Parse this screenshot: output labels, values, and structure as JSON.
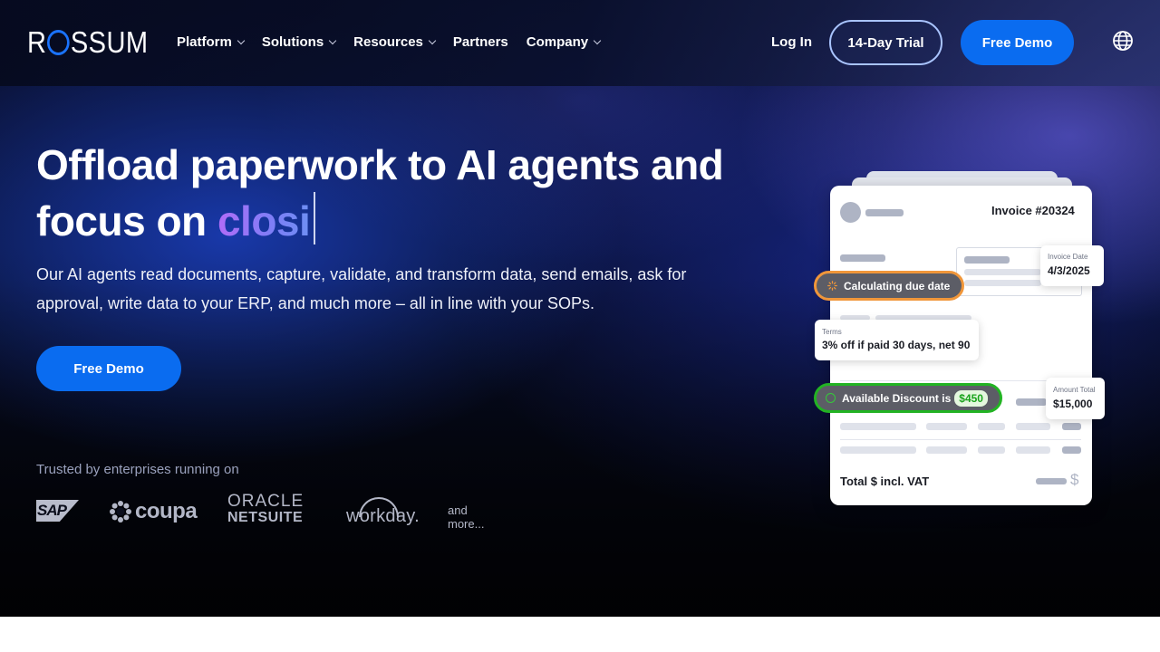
{
  "brand": {
    "logo_text_left": "R",
    "logo_text_right": "SSUM"
  },
  "nav": {
    "menu": [
      {
        "label": "Platform",
        "has_dropdown": true
      },
      {
        "label": "Solutions",
        "has_dropdown": true
      },
      {
        "label": "Resources",
        "has_dropdown": true
      },
      {
        "label": "Partners",
        "has_dropdown": false
      },
      {
        "label": "Company",
        "has_dropdown": true
      }
    ],
    "login_label": "Log In",
    "trial_label": "14-Day Trial",
    "demo_label": "Free Demo",
    "language_icon": "globe-icon"
  },
  "hero": {
    "headline_line1": "Offload paperwork to AI agents and",
    "headline_line2_prefix": "focus on ",
    "headline_typed": "closi",
    "subtext": "Our AI agents read documents, capture, validate, and transform data, send emails, ask for approval, write data to your ERP, and much more – all in line with your SOPs.",
    "cta_label": "Free Demo",
    "trusted_text": "Trusted by enterprises running on",
    "partners": {
      "sap": "SAP",
      "coupa": "coupa",
      "oracle_line1": "ORACLE",
      "oracle_line2": "NETSUITE",
      "workday": "workday.",
      "more": "and more..."
    }
  },
  "invoice": {
    "title": "Invoice #20324",
    "invoice_date_label": "Invoice Date",
    "invoice_date_value": "4/3/2025",
    "calc_label": "Calculating due date",
    "terms_label": "Terms",
    "terms_value": "3% off if paid 30 days, net 90",
    "available_label": "Available Discount is",
    "discount_value": "$450",
    "amount_total_label": "Amount Total",
    "amount_total_value": "$15,000",
    "total_label": "Total $ incl. VAT",
    "currency_symbol": "$"
  },
  "colors": {
    "accent_blue": "#0a6cf0",
    "calc_orange": "#f0963a",
    "discount_green": "#22b323",
    "typed_gradient_start": "#b06cf7",
    "typed_gradient_end": "#6e8ff3"
  }
}
